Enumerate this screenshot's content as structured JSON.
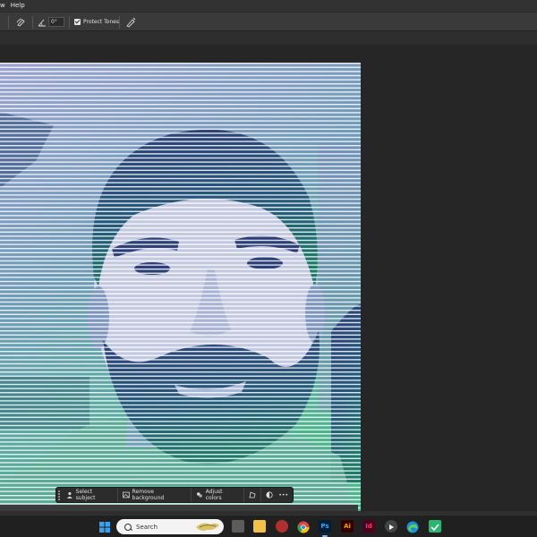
{
  "menubar": {
    "items": [
      "w",
      "Help"
    ]
  },
  "options": {
    "angle_value": "0°",
    "protect_tones_label": "Protect Tones"
  },
  "context_bar": {
    "select_subject": "Select subject",
    "remove_background": "Remove background",
    "adjust_colors": "Adjust colors",
    "more": "•••"
  },
  "taskbar": {
    "search_placeholder": "Search"
  },
  "colors": {
    "gradient_top": "#8e98c8",
    "gradient_mid": "#5f8fb0",
    "gradient_bottom": "#4fb98f",
    "accent_ps": "#31a8ff"
  }
}
